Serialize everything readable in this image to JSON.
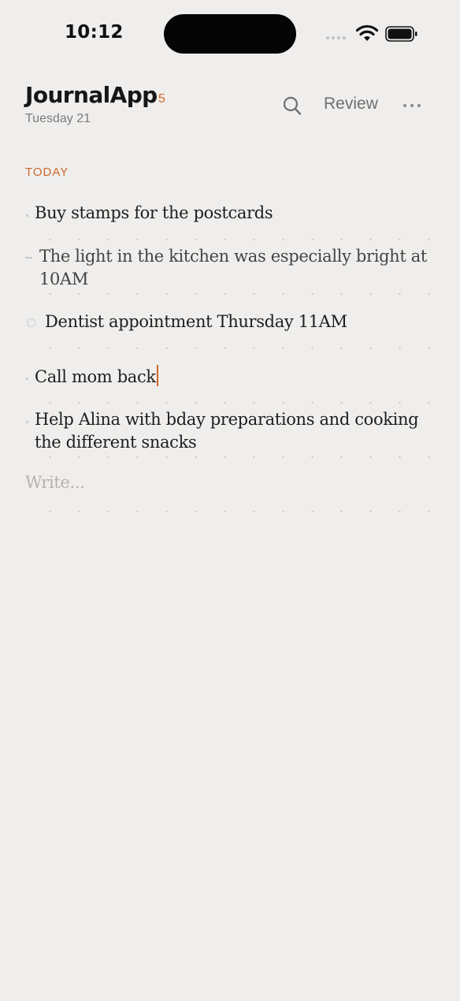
{
  "status_bar": {
    "time": "10:12"
  },
  "header": {
    "app_title": "JournalApp",
    "entry_count": "5",
    "date": "Tuesday 21",
    "review_label": "Review"
  },
  "section": {
    "label": "TODAY"
  },
  "entries": [
    {
      "text": "Buy stamps for the postcards",
      "bullet": "dot"
    },
    {
      "text": "The light in the kitchen was especially bright at 10AM",
      "bullet": "dash"
    },
    {
      "text": "Dentist appointment Thursday 11AM",
      "bullet": "circle"
    },
    {
      "text": "Call mom back",
      "bullet": "dot",
      "editing": true
    },
    {
      "text": "Help Alina with bday preparations and cooking the different snacks",
      "bullet": "dot"
    }
  ],
  "composer": {
    "placeholder": "Write..."
  },
  "colors": {
    "accent": "#c9682c",
    "background": "#f0eeec"
  },
  "icons": [
    "search-icon",
    "more-icon",
    "wifi-icon",
    "battery-icon",
    "signal-icon"
  ]
}
